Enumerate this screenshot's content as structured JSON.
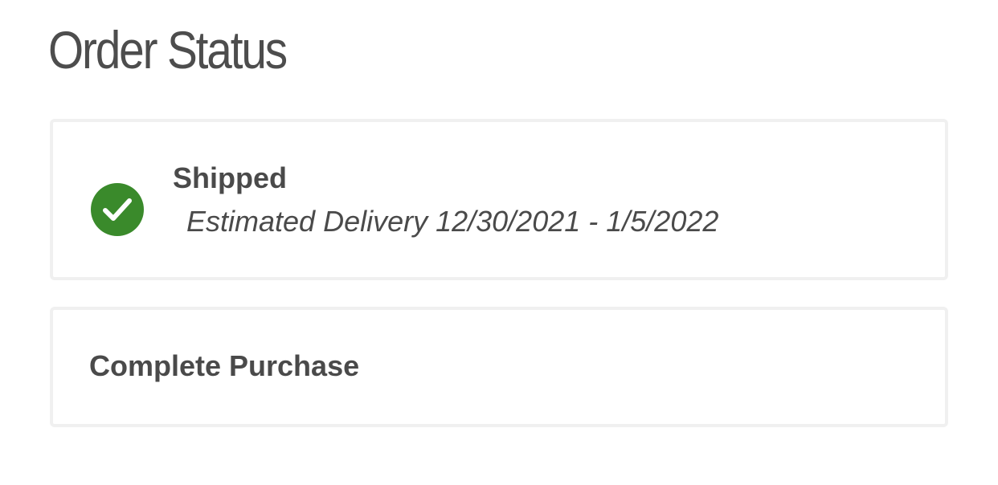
{
  "page": {
    "title": "Order Status"
  },
  "shipped_card": {
    "status": "Shipped",
    "icon": "check-circle-icon",
    "icon_color": "#3a8a2b",
    "delivery": "Estimated Delivery 12/30/2021 - 1/5/2022"
  },
  "purchase_card": {
    "label": "Complete Purchase"
  }
}
